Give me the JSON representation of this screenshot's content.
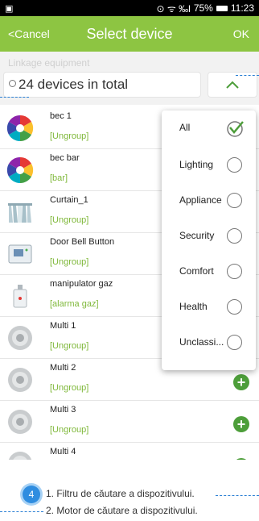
{
  "statusbar": {
    "left_icon": "image-icon",
    "signal_text": "⊙ ᯤ ‰l",
    "battery": "75%",
    "time": "11:23"
  },
  "navbar": {
    "cancel_label": "<Cancel",
    "title": "Select device",
    "ok_label": "OK",
    "background": "#8dc542"
  },
  "filter": {
    "linkage_label": "Linkage equipment",
    "search_text": "24 devices in total",
    "toggle_icon": "chevron-up-icon"
  },
  "devices": [
    {
      "name": "bec 1",
      "group": "[Ungroup]",
      "icon": "color-bulb-icon"
    },
    {
      "name": "bec bar",
      "group": "[bar]",
      "icon": "color-bulb-icon"
    },
    {
      "name": "Curtain_1",
      "group": "[Ungroup]",
      "icon": "curtain-icon"
    },
    {
      "name": "Door Bell Button",
      "group": "[Ungroup]",
      "icon": "doorbell-icon"
    },
    {
      "name": "manipulator gaz",
      "group": "[alarma gaz]",
      "icon": "gas-valve-icon"
    },
    {
      "name": "Multi 1",
      "group": "[Ungroup]",
      "icon": "multi-sensor-icon"
    },
    {
      "name": "Multi 2",
      "group": "[Ungroup]",
      "icon": "multi-sensor-icon"
    },
    {
      "name": "Multi 3",
      "group": "[Ungroup]",
      "icon": "multi-sensor-icon"
    },
    {
      "name": "Multi 4",
      "group": "",
      "icon": "multi-sensor-icon"
    }
  ],
  "dropdown": {
    "items": [
      {
        "label": "All",
        "selected": true
      },
      {
        "label": "Lighting",
        "selected": false
      },
      {
        "label": "Appliance",
        "selected": false
      },
      {
        "label": "Security",
        "selected": false
      },
      {
        "label": "Comfort",
        "selected": false
      },
      {
        "label": "Health",
        "selected": false
      },
      {
        "label": "Unclassi...",
        "selected": false
      }
    ]
  },
  "footer": {
    "badge_number": "4",
    "note1": "1. Filtru de căutare a dispozitivului.",
    "note2": "2. Motor de căutare a dispozitivului."
  },
  "colors": {
    "accent_green": "#8dc542",
    "group_text": "#7fb83a",
    "plus_button": "#4d9e3a",
    "badge_blue": "#2f8de0"
  }
}
